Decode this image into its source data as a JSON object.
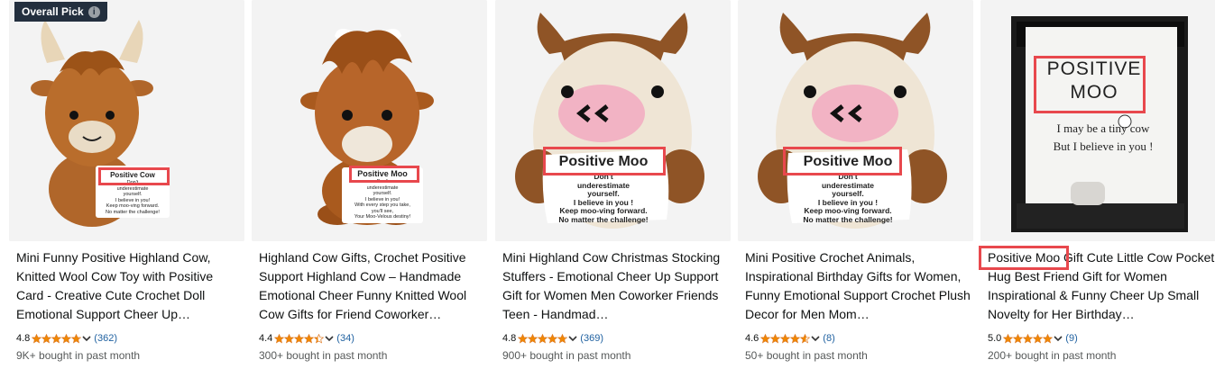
{
  "badge": {
    "label": "Overall Pick",
    "icon": "info-icon"
  },
  "colors": {
    "star": "#f08804",
    "link": "#2162a1",
    "muted": "#565959",
    "highlight": "#e8484d",
    "badge_bg": "#232f3e"
  },
  "products": [
    {
      "title": "Mini Funny Positive Highland Cow, Knitted Wool Cow Toy with Positive Card - Creative Cute Crochet Doll Emotional Support Cheer Up…",
      "rating": "4.8",
      "stars": 4.8,
      "reviews": "(362)",
      "bought": "9K+ bought in past month",
      "card": {
        "heading": "Positive Cow",
        "lines": [
          "Don't",
          "underestimate",
          "yourself.",
          "I believe in you!",
          "Keep moo-ving forward.",
          "No matter the challenge!"
        ]
      }
    },
    {
      "title": "Highland Cow Gifts, Crochet Positive Support Highland Cow – Handmade Emotional Cheer Funny Knitted Wool Cow Gifts for Friend Coworker…",
      "rating": "4.4",
      "stars": 4.4,
      "reviews": "(34)",
      "bought": "300+ bought in past month",
      "card": {
        "heading": "Positive Moo",
        "lines": [
          "Don't",
          "underestimate",
          "yourself.",
          "I believe in you!",
          "With every step you take,",
          "you'll see,",
          "Your Moo-Velous destiny!"
        ]
      }
    },
    {
      "title": "Mini Highland Cow Christmas Stocking Stuffers - Emotional Cheer Up Support Gift for Women Men Coworker Friends Teen - Handmad…",
      "rating": "4.8",
      "stars": 4.8,
      "reviews": "(369)",
      "bought": "900+ bought in past month",
      "card": {
        "heading": "Positive Moo",
        "lines": [
          "Don't",
          "underestimate",
          "yourself.",
          "I believe in you !",
          "Keep moo-ving forward.",
          "No matter the challenge!"
        ]
      }
    },
    {
      "title": "Mini Positive Crochet Animals, Inspirational Birthday Gifts for Women, Funny Emotional Support Crochet Plush Decor for Men Mom…",
      "rating": "4.6",
      "stars": 4.6,
      "reviews": "(8)",
      "bought": "50+ bought in past month",
      "card": {
        "heading": "Positive Moo",
        "lines": [
          "Don't",
          "underestimate",
          "yourself.",
          "I believe in you !",
          "Keep moo-ving forward.",
          "No matter the challenge!"
        ]
      }
    },
    {
      "title": "Positive Moo Gift Cute Little Cow Pocket Hug Best Friend Gift for Women Inspirational & Funny Cheer Up Small Novelty for Her Birthday…",
      "rating": "5.0",
      "stars": 5.0,
      "reviews": "(9)",
      "bought": "200+ bought in past month",
      "card": {
        "heading_line1": "POSITIVE",
        "heading_line2": "MOO",
        "lines": [
          "I may be a tiny cow",
          "But I believe in you !"
        ]
      }
    }
  ]
}
